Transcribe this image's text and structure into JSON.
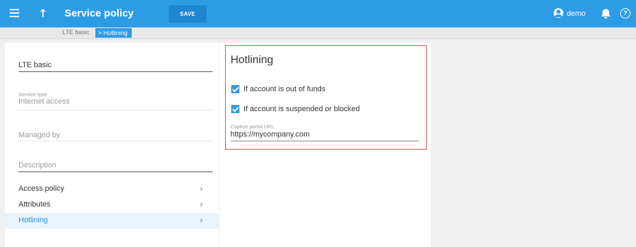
{
  "header": {
    "title": "Service policy",
    "save_label": "SAVE",
    "user_name": "demo",
    "help_glyph": "?",
    "up_arrow": "↑",
    "icons": [
      "menu-icon",
      "up-arrow-icon",
      "user-icon",
      "bell-icon",
      "help-icon"
    ],
    "accent_color": "#2e9ce5"
  },
  "breadcrumb": {
    "items": [
      "LTE basic",
      "> Hotlining"
    ]
  },
  "left_panel": {
    "name_value": "LTE basic",
    "service_type_label": "Service type",
    "service_type_value": "Internet access",
    "managed_by_placeholder": "Managed by",
    "description_placeholder": "Description",
    "chevron": "›",
    "nav": [
      {
        "label": "Access policy"
      },
      {
        "label": "Attributes"
      },
      {
        "label": "Hotlining"
      }
    ]
  },
  "hotlining": {
    "title": "Hotlining",
    "checkbox_out_of_funds": {
      "label": "If account is out of funds",
      "checked": true
    },
    "checkbox_suspended": {
      "label": "If account is suspended or blocked",
      "checked": true
    },
    "url_label": "Captive portal URL",
    "url_value": "https://mycompany.com",
    "highlight_color": "#d9534f"
  }
}
